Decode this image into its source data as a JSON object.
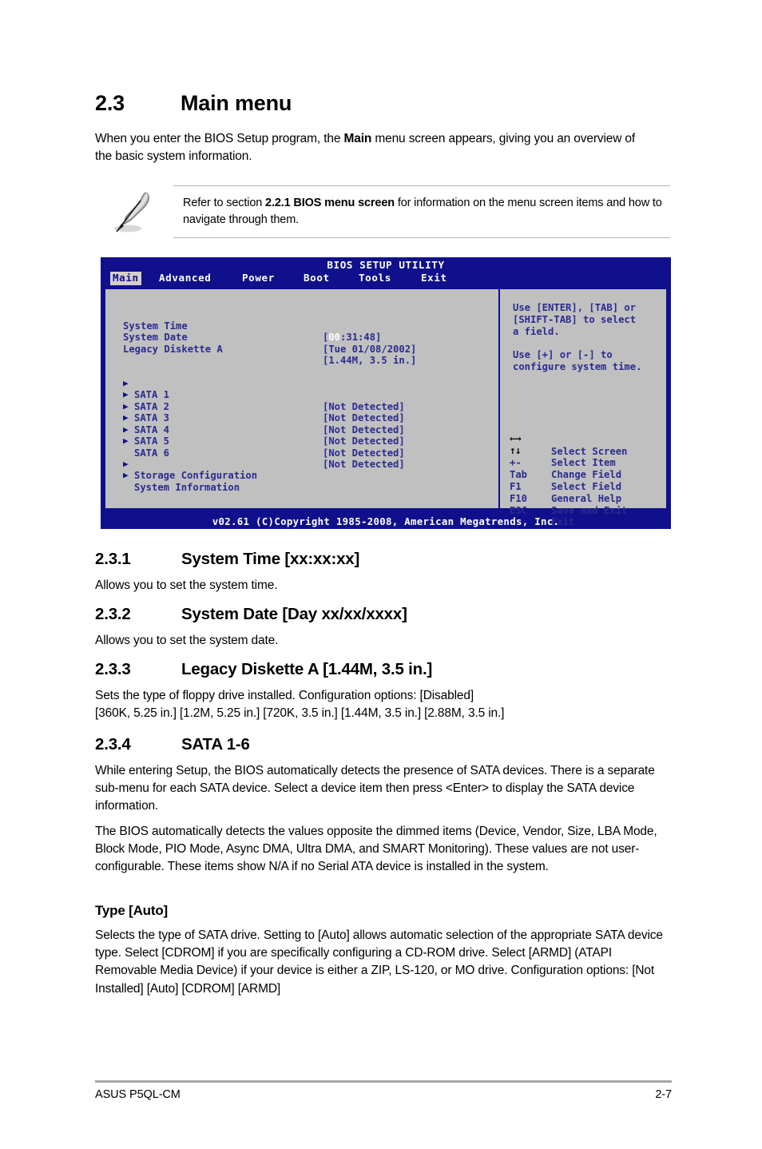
{
  "heading": {
    "number": "2.3",
    "title": "Main menu"
  },
  "intro": "When you enter the BIOS Setup program, the <b>Main</b> menu screen appears, giving you an overview of the basic system information.",
  "note": {
    "icon": "pencil-icon",
    "text": "Refer to section <b>2.2.1 BIOS menu screen</b> for information on the menu screen items and how to navigate through them."
  },
  "bios": {
    "title": "BIOS SETUP UTILITY",
    "tabs": [
      {
        "label": "Main",
        "active": true
      },
      {
        "label": "Advanced",
        "active": false
      },
      {
        "label": "Power",
        "active": false
      },
      {
        "label": "Boot",
        "active": false
      },
      {
        "label": "Tools",
        "active": false
      },
      {
        "label": "Exit",
        "active": false
      }
    ],
    "fields": [
      {
        "label": "System Time",
        "value_prefix": "[",
        "value_highlight": "00",
        "value_suffix": ":31:48]"
      },
      {
        "label": "System Date",
        "value": "[Tue 01/08/2002]"
      },
      {
        "label": "Legacy Diskette A",
        "value": "[1.44M, 3.5 in.]"
      }
    ],
    "sata": [
      {
        "label": "SATA 1",
        "value": "[Not Detected]"
      },
      {
        "label": "SATA 2",
        "value": "[Not Detected]"
      },
      {
        "label": "SATA 3",
        "value": "[Not Detected]"
      },
      {
        "label": "SATA 4",
        "value": "[Not Detected]"
      },
      {
        "label": "SATA 5",
        "value": "[Not Detected]"
      },
      {
        "label": "SATA 6",
        "value": "[Not Detected]"
      }
    ],
    "submenus": [
      {
        "label": "Storage Configuration"
      },
      {
        "label": "System Information"
      }
    ],
    "help": "Use [ENTER], [TAB] or\n[SHIFT-TAB] to select\na field.\n\nUse [+] or [-] to\nconfigure system time.",
    "keys": [
      {
        "key": "←→",
        "is_glyph": true,
        "desc": "Select Screen"
      },
      {
        "key": "↑↓",
        "is_glyph": true,
        "desc": "Select Item"
      },
      {
        "key": "+-",
        "is_glyph": false,
        "desc": "Change Field"
      },
      {
        "key": "Tab",
        "is_glyph": false,
        "desc": "Select Field"
      },
      {
        "key": "F1",
        "is_glyph": false,
        "desc": "General Help"
      },
      {
        "key": "F10",
        "is_glyph": false,
        "desc": "Save and Exit"
      },
      {
        "key": "ESC",
        "is_glyph": false,
        "desc": "Exit"
      }
    ],
    "footer": "v02.61 (C)Copyright 1985-2008, American Megatrends, Inc.",
    "colors": {
      "header_blue": "#10108C",
      "panel_gray": "#C0C0C0",
      "text_blue": "#2B2B8F",
      "active_tab_bg": "#D4D0C8",
      "highlight_white": "#FFFFFF"
    }
  },
  "sections": {
    "s231": {
      "number": "2.3.1",
      "title": "System Time [xx:xx:xx]",
      "body": "Allows you to set the system time."
    },
    "s232": {
      "number": "2.3.2",
      "title": "System Date [Day xx/xx/xxxx]",
      "body": "Allows you to set the system date."
    },
    "s233": {
      "number": "2.3.3",
      "title": "Legacy Diskette A [1.44M, 3.5 in.]",
      "body": "Sets the type of floppy drive installed. Configuration options: [Disabled]<br>[360K, 5.25 in.] [1.2M, 5.25 in.] [720K, 3.5 in.] [1.44M, 3.5 in.] [2.88M, 3.5 in.]"
    },
    "s234": {
      "number": "2.3.4",
      "title": "SATA 1-6",
      "body1": "While entering Setup, the BIOS automatically detects the presence of SATA devices. There is a separate sub-menu for each SATA device. Select a device item then press &lt;Enter&gt; to display the SATA device information.",
      "body2": "The BIOS automatically detects the values opposite the dimmed items (Device, Vendor, Size, LBA Mode, Block Mode, PIO Mode, Async DMA, Ultra DMA, and SMART Monitoring). These values are not user-configurable. These items show N/A if no Serial ATA device is installed in the system."
    },
    "type": {
      "title": "Type [Auto]",
      "body": "Selects the type of SATA drive. Setting to [Auto] allows automatic selection of the appropriate SATA device type. Select [CDROM] if you are specifically configuring a CD-ROM drive. Select [ARMD] (ATAPI Removable Media Device) if your device is either a ZIP, LS-120, or MO drive. Configuration options: [Not Installed] [Auto] [CDROM] [ARMD]"
    }
  },
  "footer": {
    "left": "ASUS P5QL-CM",
    "right": "2-7"
  }
}
